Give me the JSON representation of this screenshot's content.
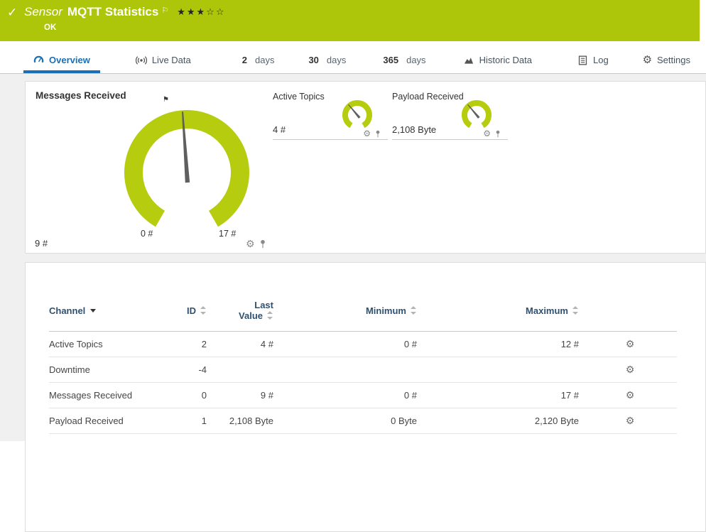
{
  "colors": {
    "brand_green": "#adc60a",
    "gauge_green": "#b6cc0f",
    "accent_blue": "#1a6fb5",
    "table_header_text": "#2f506e",
    "body_text": "#454545",
    "content_bg": "#f0f0f0",
    "needle_gray": "#5f5f5f"
  },
  "icons": {
    "check": "✓",
    "flag": "⚑",
    "flag_outline": "⚐",
    "gear": "⚙"
  },
  "header": {
    "object_kind": "Sensor",
    "title": "MQTT Statistics",
    "rating_stars": "★★★☆☆",
    "status_text": "OK"
  },
  "tabs": {
    "overview": "Overview",
    "live_data": "Live Data",
    "d2_num": "2",
    "d2_label": "days",
    "d30_num": "30",
    "d30_label": "days",
    "d365_num": "365",
    "d365_label": "days",
    "historic": "Historic Data",
    "log": "Log",
    "settings": "Settings"
  },
  "chart_data": [
    {
      "type": "gauge",
      "title": "Messages Received",
      "value": 9,
      "unit": "#",
      "value_label": "9 #",
      "min": 0,
      "max": 17,
      "scale_min_label": "0 #",
      "scale_max_label": "17 #",
      "arc_sweep_deg": 300,
      "needle_angle_deg": -4
    },
    {
      "type": "gauge",
      "title": "Active Topics",
      "value": 4,
      "unit": "#",
      "value_label": "4 #",
      "arc_sweep_deg": 300,
      "needle_angle_deg": -40
    },
    {
      "type": "gauge",
      "title": "Payload Received",
      "value": 2108,
      "unit": "Byte",
      "value_label": "2,108 Byte",
      "arc_sweep_deg": 300,
      "needle_angle_deg": -40
    }
  ],
  "table": {
    "headers": {
      "channel": "Channel",
      "id": "ID",
      "last_value_l1": "Last",
      "last_value_l2": "Value",
      "minimum": "Minimum",
      "maximum": "Maximum"
    },
    "rows": [
      {
        "channel": "Active Topics",
        "id": "2",
        "last": "4 #",
        "min": "0 #",
        "max": "12 #"
      },
      {
        "channel": "Downtime",
        "id": "-4",
        "last": "",
        "min": "",
        "max": ""
      },
      {
        "channel": "Messages Received",
        "id": "0",
        "last": "9 #",
        "min": "0 #",
        "max": "17 #"
      },
      {
        "channel": "Payload Received",
        "id": "1",
        "last": "2,108 Byte",
        "min": "0 Byte",
        "max": "2,120 Byte"
      }
    ]
  }
}
